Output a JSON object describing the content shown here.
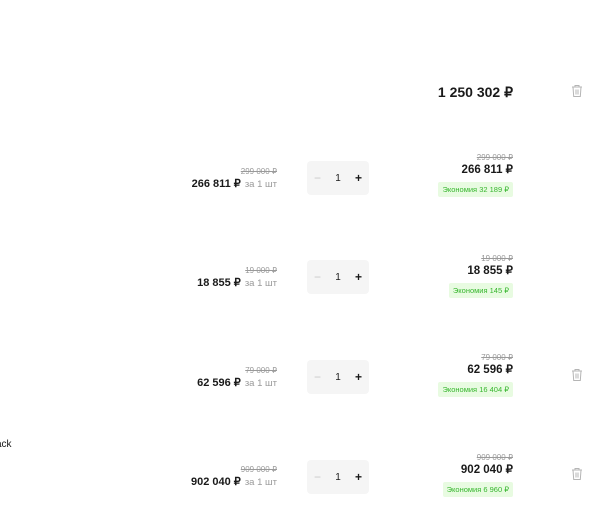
{
  "cart": {
    "group_total": "1 250 302 ₽",
    "side_text": "ack",
    "items": [
      {
        "old_price": "299 000 ₽",
        "price": "266 811 ₽",
        "per_unit": "за 1 шт",
        "quantity": "1",
        "line_old": "299 000 ₽",
        "line_total": "266 811 ₽",
        "saving": "Экономия 32 189 ₽",
        "trash_visible": false
      },
      {
        "old_price": "19 000 ₽",
        "price": "18 855 ₽",
        "per_unit": "за 1 шт",
        "quantity": "1",
        "line_old": "19 000 ₽",
        "line_total": "18 855 ₽",
        "saving": "Экономия 145 ₽",
        "trash_visible": false
      },
      {
        "old_price": "79 000 ₽",
        "price": "62 596 ₽",
        "per_unit": "за 1 шт",
        "quantity": "1",
        "line_old": "79 000 ₽",
        "line_total": "62 596 ₽",
        "saving": "Экономия 16 404 ₽",
        "trash_visible": true
      },
      {
        "old_price": "909 000 ₽",
        "price": "902 040 ₽",
        "per_unit": "за 1 шт",
        "quantity": "1",
        "line_old": "909 000 ₽",
        "line_total": "902 040 ₽",
        "saving": "Экономия 6 960 ₽",
        "trash_visible": true
      }
    ],
    "stepper": {
      "minus": "−",
      "plus": "+"
    },
    "colors": {
      "saving_bg": "#e8fbe1",
      "saving_text": "#36b62d",
      "muted": "#9a9a9a",
      "stepper_bg": "#f5f5f5"
    }
  }
}
